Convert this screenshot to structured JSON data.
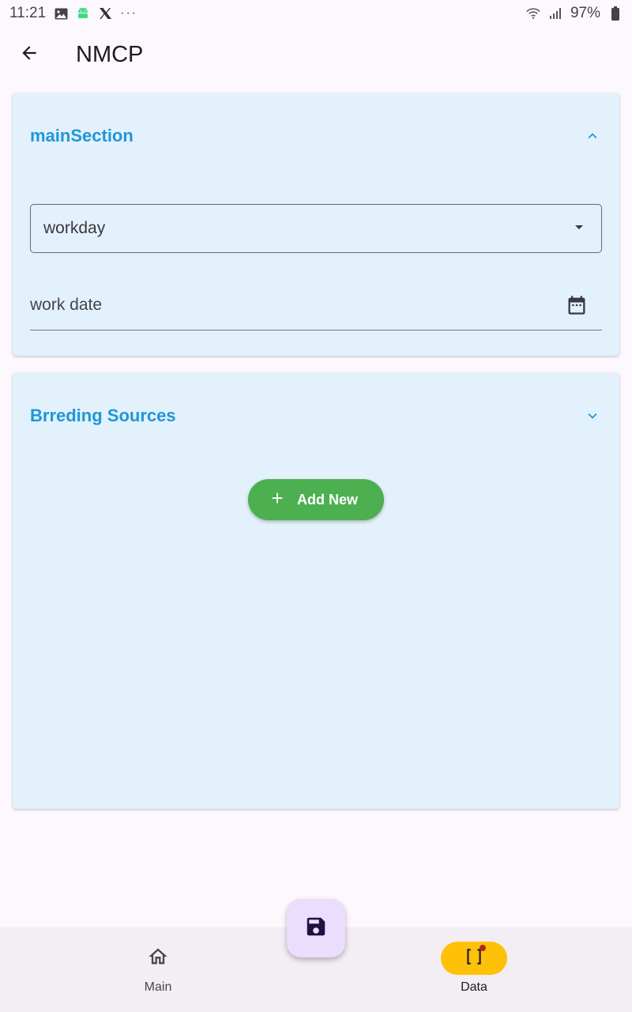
{
  "status_bar": {
    "time": "11:21",
    "notification_icons": [
      "image-icon",
      "android-icon",
      "x-icon"
    ],
    "more": "···",
    "battery": "97%"
  },
  "app_bar": {
    "title": "NMCP"
  },
  "main_section": {
    "title": "mainSection",
    "expanded": true,
    "workday_dropdown": {
      "value": "workday"
    },
    "work_date_field": {
      "label": "work date"
    }
  },
  "breeding_section": {
    "title": "Brreding Sources",
    "expanded": false,
    "add_button_label": "Add New"
  },
  "bottom_nav": {
    "items": [
      {
        "label": "Main",
        "icon": "home-icon",
        "selected": false
      },
      {
        "label": "Data",
        "icon": "brackets-icon",
        "selected": true,
        "badge": true
      }
    ]
  },
  "fab": {
    "icon": "save-icon"
  },
  "colors": {
    "accent": "#2196d8",
    "card_bg": "#e2f1fb",
    "add_button": "#4caf50",
    "nav_selected": "#ffc107",
    "fab_bg": "#ebddfd"
  }
}
